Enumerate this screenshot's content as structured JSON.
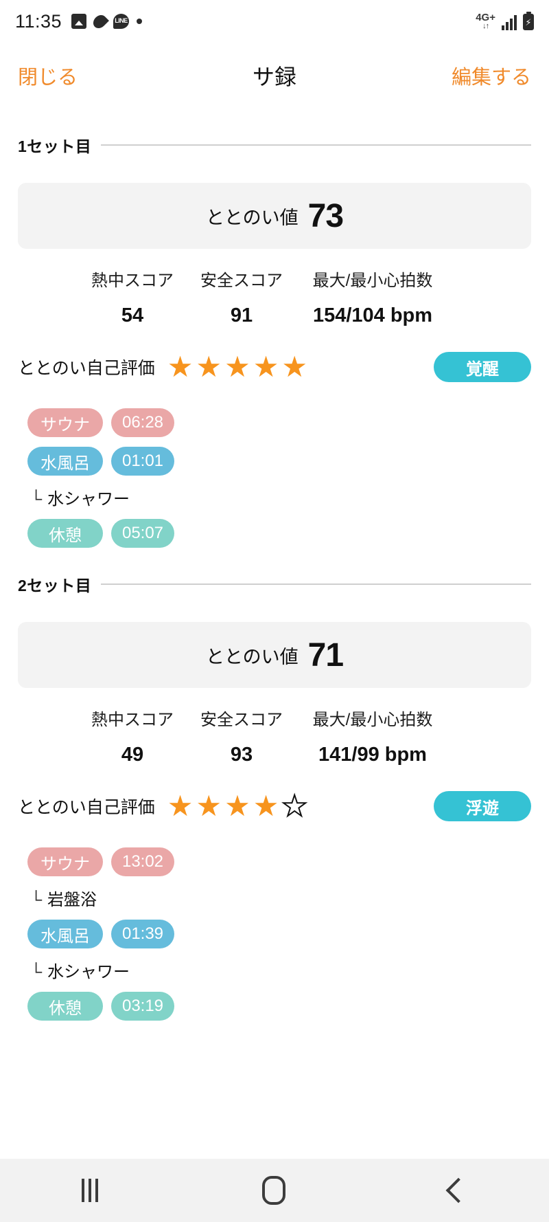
{
  "statusbar": {
    "time": "11:35",
    "left_icons": [
      "photo-icon",
      "droplet-icon",
      "line-icon",
      "dot-icon"
    ],
    "network_label": "4G+",
    "network_sub": "↓↑",
    "battery_glyph": "⚡"
  },
  "navbar": {
    "close_label": "閉じる",
    "title": "サ録",
    "edit_label": "編集する"
  },
  "sets": [
    {
      "title": "1セット目",
      "score_label": "ととのい値",
      "score_value": "73",
      "metrics": [
        {
          "label": "熱中スコア",
          "value": "54"
        },
        {
          "label": "安全スコア",
          "value": "91"
        },
        {
          "label": "最大/最小心拍数",
          "value": "154/104 bpm"
        }
      ],
      "rating_label": "ととのい自己評価",
      "rating_filled": 5,
      "rating_total": 5,
      "badge": "覚醒",
      "phases": [
        {
          "kind": "pill",
          "name": "サウナ",
          "time": "06:28",
          "color": "sauna"
        },
        {
          "kind": "pill",
          "name": "水風呂",
          "time": "01:01",
          "color": "mizuburo"
        },
        {
          "kind": "sub",
          "name": "水シャワー"
        },
        {
          "kind": "pill",
          "name": "休憩",
          "time": "05:07",
          "color": "kyukei"
        }
      ]
    },
    {
      "title": "2セット目",
      "score_label": "ととのい値",
      "score_value": "71",
      "metrics": [
        {
          "label": "熱中スコア",
          "value": "49"
        },
        {
          "label": "安全スコア",
          "value": "93"
        },
        {
          "label": "最大/最小心拍数",
          "value": "141/99 bpm"
        }
      ],
      "rating_label": "ととのい自己評価",
      "rating_filled": 4,
      "rating_total": 5,
      "badge": "浮遊",
      "phases": [
        {
          "kind": "pill",
          "name": "サウナ",
          "time": "13:02",
          "color": "sauna"
        },
        {
          "kind": "sub",
          "name": "岩盤浴"
        },
        {
          "kind": "pill",
          "name": "水風呂",
          "time": "01:39",
          "color": "mizuburo"
        },
        {
          "kind": "sub",
          "name": "水シャワー"
        },
        {
          "kind": "pill",
          "name": "休憩",
          "time": "03:19",
          "color": "kyukei"
        }
      ]
    }
  ],
  "sub_prefix": "└",
  "star_filled_glyph": "★",
  "star_empty_glyph": "★",
  "androidnav": {
    "recent_label": "recent-apps",
    "home_label": "home",
    "back_label": "back"
  },
  "colors": {
    "accent_orange": "#f08a2b",
    "star_orange": "#f7941e",
    "badge_teal": "#35c2d4",
    "sauna_pink": "#eaa7a7",
    "mizuburo_blue": "#65bcdc",
    "kyukei_green": "#81d3c8",
    "card_gray": "#f3f3f3"
  }
}
